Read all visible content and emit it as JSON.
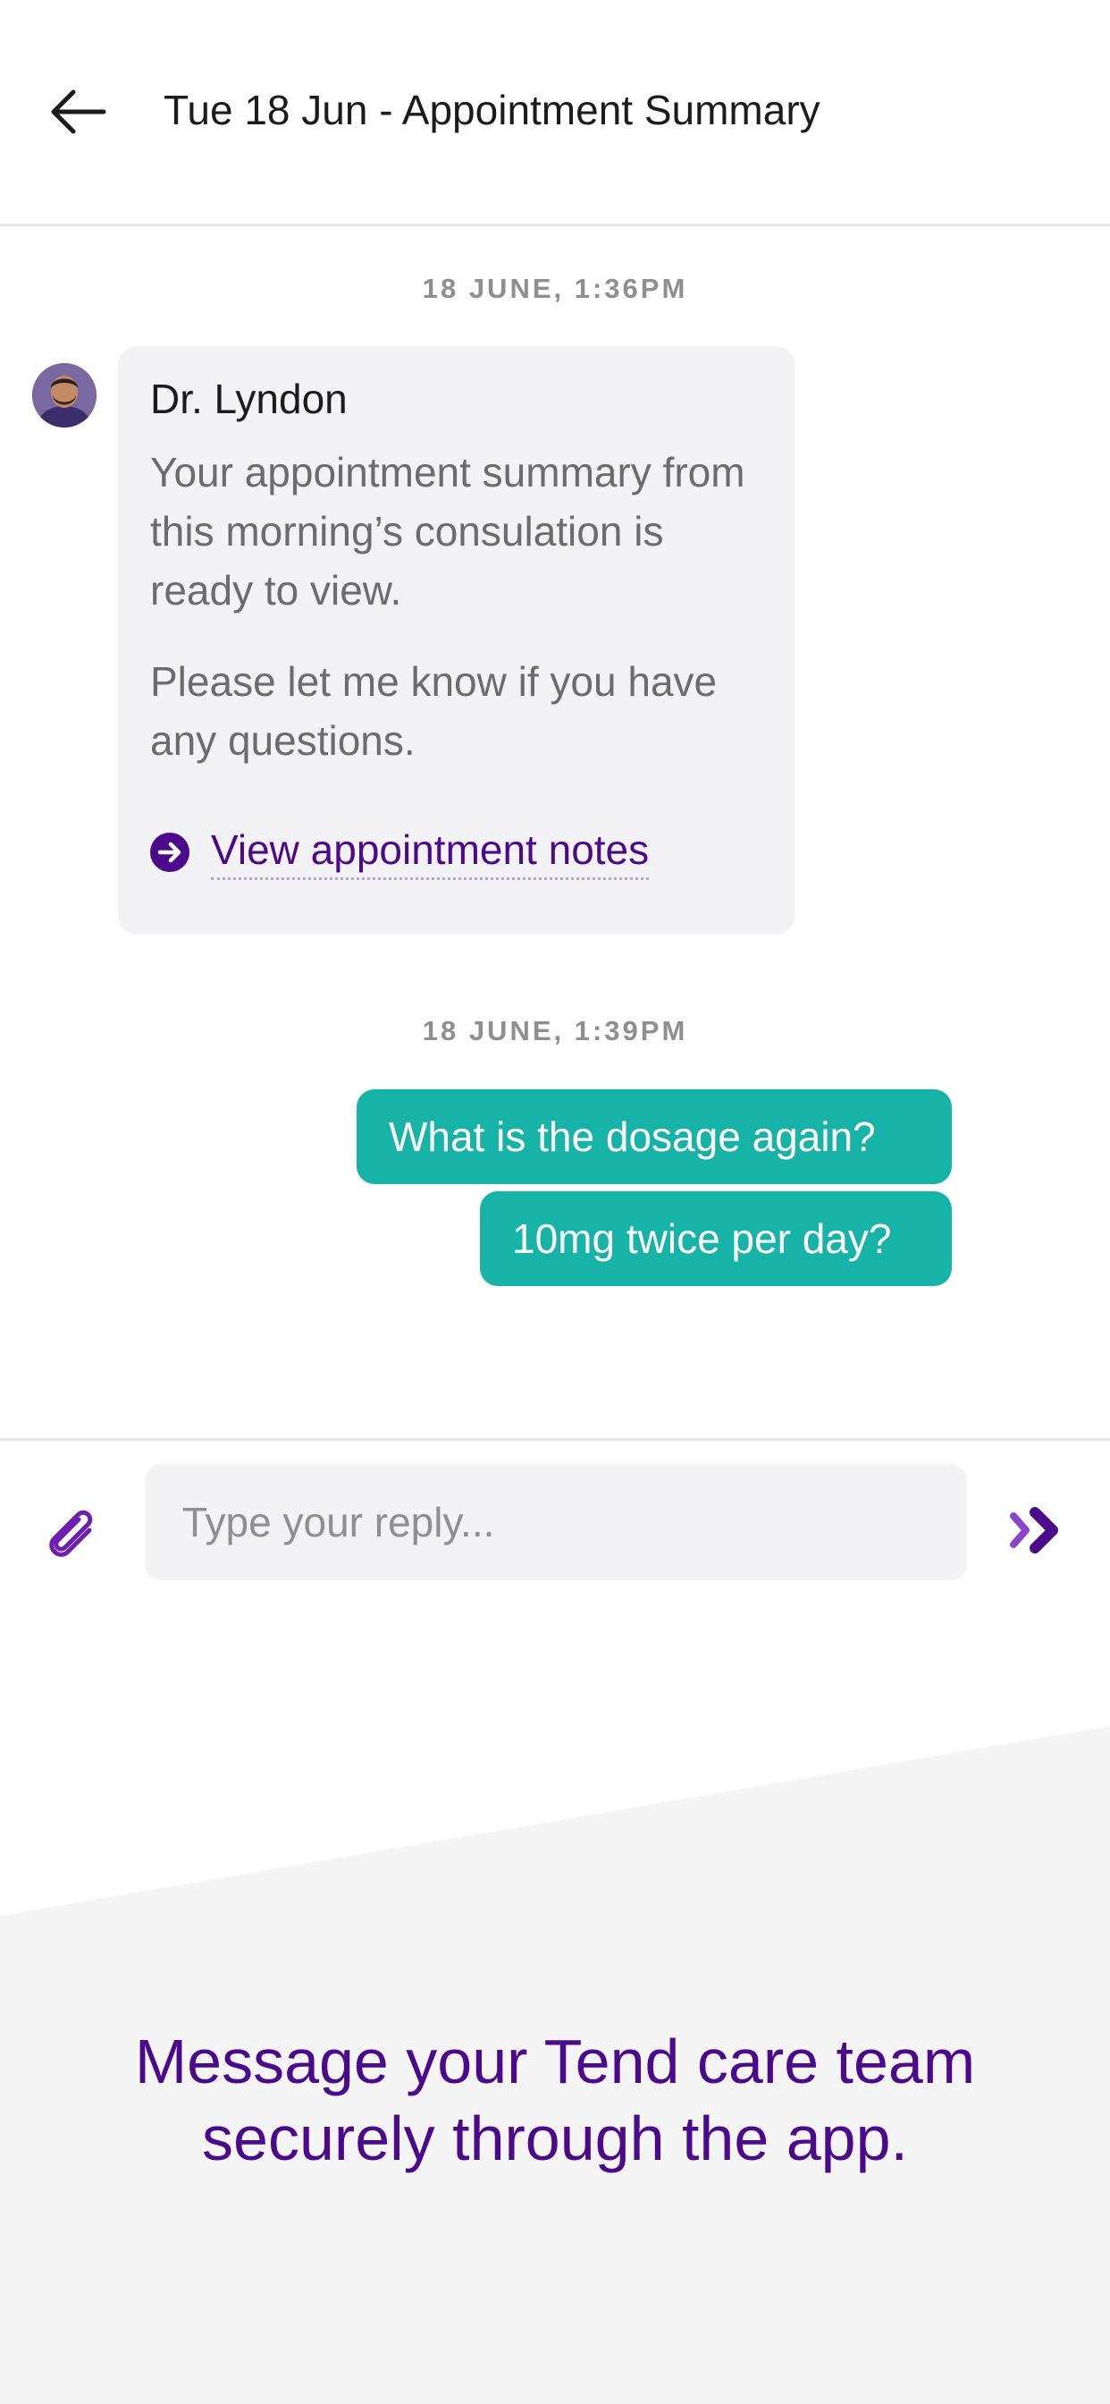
{
  "header": {
    "back_icon": "arrow-left-icon",
    "title": "Tue 18 Jun - Appointment Summary"
  },
  "conversation": {
    "groups": [
      {
        "timestamp": "18 JUNE, 1:36PM",
        "message": {
          "sender": "Dr. Lyndon",
          "avatar_icon": "doctor-avatar",
          "paragraphs": [
            "Your appointment summary from this morning’s consulation is ready to view.",
            "Please let me know if you have any questions."
          ],
          "link": {
            "icon": "arrow-right-circle-icon",
            "label": "View appointment notes"
          }
        }
      },
      {
        "timestamp": "18 JUNE, 1:39PM",
        "replies": [
          "What is the dosage again?",
          "10mg twice per day?"
        ]
      }
    ]
  },
  "composer": {
    "attach_icon": "paperclip-icon",
    "placeholder": "Type your reply...",
    "send_icon": "send-chevrons-icon"
  },
  "promo": {
    "line1": "Message your Tend care team",
    "line2": "securely through the app."
  },
  "colors": {
    "brand_purple": "#4b0a8c",
    "accent_purple": "#8a46c8",
    "outgoing_bubble": "#17b3a6",
    "incoming_bubble": "#f3f3f5",
    "promo_background": "#f5f5f6"
  }
}
